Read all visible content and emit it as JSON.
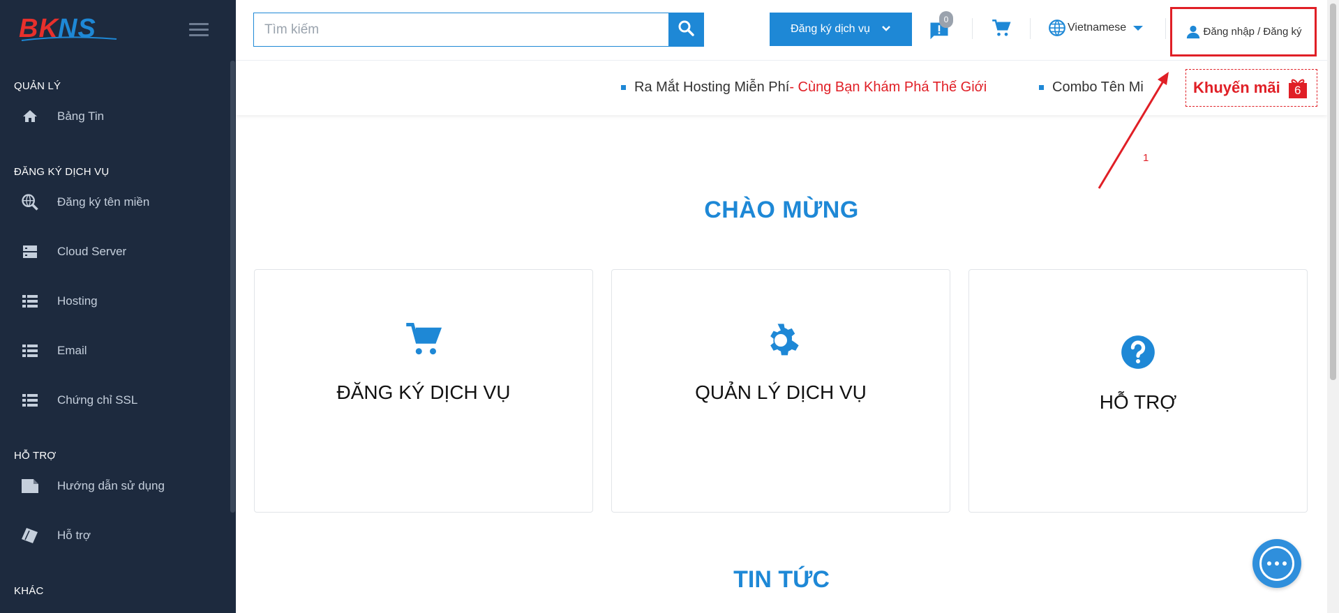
{
  "brand": {
    "logo_text": "BKNS"
  },
  "sidebar": {
    "sections": [
      {
        "title": "QUẢN LÝ"
      },
      {
        "title": "ĐĂNG KÝ DỊCH VỤ"
      },
      {
        "title": "HỖ TRỢ"
      },
      {
        "title": "KHÁC"
      }
    ],
    "items": [
      {
        "label": "Bảng Tin",
        "icon": "home-icon"
      },
      {
        "label": "Đăng ký tên miền",
        "icon": "domain-search-icon"
      },
      {
        "label": "Cloud Server",
        "icon": "server-icon"
      },
      {
        "label": "Hosting",
        "icon": "list-icon"
      },
      {
        "label": "Email",
        "icon": "list-icon"
      },
      {
        "label": "Chứng chỉ SSL",
        "icon": "list-icon"
      },
      {
        "label": "Hướng dẫn sử dụng",
        "icon": "document-icon"
      },
      {
        "label": "Hỗ trợ",
        "icon": "ticket-icon"
      }
    ]
  },
  "topbar": {
    "search_placeholder": "Tìm kiếm",
    "register_label": "Đăng ký dịch vụ",
    "messages_count": "0",
    "language": "Vietnamese",
    "login_label": "Đăng nhập / Đăng ký"
  },
  "ticker": {
    "item1_main": "Ra Mắt Hosting Miễn Phí",
    "item1_highlight": " - Cùng Bạn Khám Phá Thế Giới",
    "item2": "Combo Tên Mi",
    "promo_label": "Khuyến mãi",
    "promo_count": "6"
  },
  "annotation": {
    "label": "1"
  },
  "main": {
    "welcome_title": "CHÀO MỪNG",
    "cards": [
      {
        "label": "ĐĂNG KÝ DỊCH VỤ",
        "icon": "cart-icon"
      },
      {
        "label": "QUẢN LÝ DỊCH VỤ",
        "icon": "gear-icon"
      },
      {
        "label": "HỖ TRỢ",
        "icon": "help-icon"
      }
    ],
    "news_title": "TIN TỨC"
  },
  "colors": {
    "accent": "#1e88d6",
    "sidebar_bg": "#1d2a3e",
    "alert": "#e01f26"
  }
}
